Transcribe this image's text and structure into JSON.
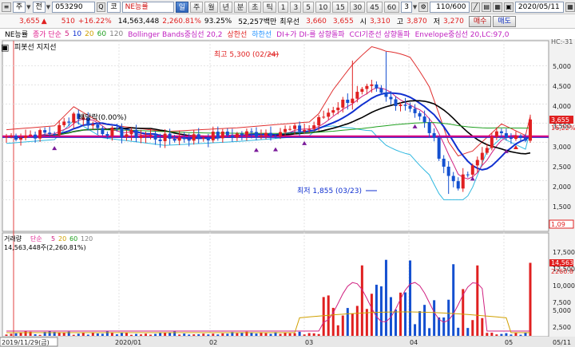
{
  "toolbar": {
    "type_label": "주",
    "mode_label": "전",
    "code": "053290",
    "market_label": "코",
    "stock_name": "NE능률",
    "period_buttons": [
      "일",
      "주",
      "월",
      "년",
      "분",
      "초",
      "틱"
    ],
    "minute_buttons": [
      "1",
      "3",
      "5",
      "10",
      "15",
      "30",
      "45",
      "60"
    ],
    "minute_select": "3",
    "count": "110/600",
    "date": "2020/05/11"
  },
  "quote": {
    "price": "3,655",
    "arrow": "▲",
    "change": "510",
    "change_pct": "+16.22%",
    "volume": "14,563,448",
    "volume_pct": "2,260.81%",
    "ratio": "93.25%",
    "amount": "52,257백만",
    "priority_label": "최우선",
    "ask": "3,660",
    "bid": "3,655",
    "open_label": "시",
    "open": "3,310",
    "high_label": "고",
    "high": "3,870",
    "low_label": "저",
    "low": "3,270",
    "buy_label": "매수",
    "sell_label": "매도"
  },
  "legend": {
    "items": [
      {
        "text": "NE능률",
        "color": "#000000"
      },
      {
        "text": "종가 단순",
        "color": "#e0208f"
      },
      {
        "text": "5",
        "color": "#d02080"
      },
      {
        "text": "10",
        "color": "#1030d0"
      },
      {
        "text": "20",
        "color": "#d0a000"
      },
      {
        "text": "60",
        "color": "#20a020"
      },
      {
        "text": "120",
        "color": "#808080"
      },
      {
        "text": "Bollinger Bands중심선 20,2",
        "color": "#c020c0"
      },
      {
        "text": "상한선",
        "color": "#e02020"
      },
      {
        "text": "하한선",
        "color": "#1e90ff"
      },
      {
        "text": "DI+가 DI-를 상향돌파",
        "color": "#c020c0"
      },
      {
        "text": "CCI기준선 상향돌파",
        "color": "#c020c0"
      },
      {
        "text": "Envelope중심선 20,LC:97,0",
        "color": "#c020c0"
      }
    ]
  },
  "chart": {
    "hc_label": "HC:-31",
    "sub_label": "피봇선  지지선",
    "max_annotation": "최고 5,300 (02/24)",
    "min_annotation": "최저 1,855 (03/23)",
    "dividend_annotation": "배당락(0.00%)",
    "price_axis": [
      "5,000",
      "4,500",
      "4,000",
      "3,500",
      "3,000",
      "2,500",
      "2,000",
      "1,500"
    ],
    "price_tags": [
      "3,655",
      "16,22%"
    ],
    "right_tag": "1,09",
    "volume_legend": [
      "거래량",
      "단순",
      "5",
      "20",
      "60",
      "120"
    ],
    "volume_current": "14,563,448주(2,260.81%)",
    "volume_axis": [
      "17,500",
      "12,500",
      "10,000",
      "7,500",
      "5,000",
      "2,500"
    ],
    "volume_tags": [
      "14,563",
      "2260.8"
    ],
    "x_labels": [
      "2019/11/29(금)",
      "2020/01",
      "02",
      "03",
      "04",
      "05",
      "05/11"
    ]
  },
  "colors": {
    "up": "#e02020",
    "down": "#1450d0",
    "pivot": "#e0007f",
    "bb_upper": "#e03030",
    "bb_lower": "#30b8e0",
    "ma5": "#d02080",
    "ma10": "#1030d0",
    "ma20": "#d0a000",
    "ma60": "#20a020"
  }
}
